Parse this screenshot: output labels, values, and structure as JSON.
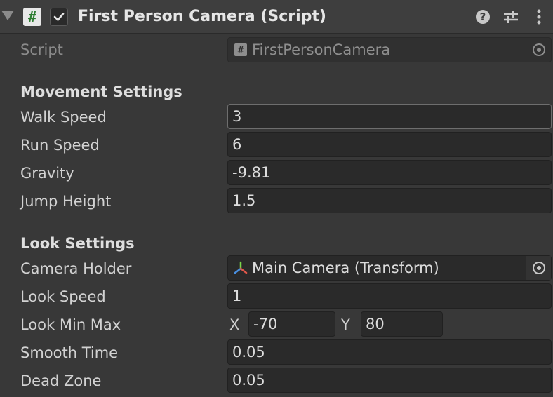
{
  "component": {
    "title": "First Person Camera (Script)",
    "enabled": true,
    "icons": {
      "script": "#",
      "help": "help-icon",
      "presets": "sliders-icon",
      "menu": "kebab-menu-icon"
    }
  },
  "script_field": {
    "label": "Script",
    "value": "FirstPersonCamera"
  },
  "movement": {
    "heading": "Movement Settings",
    "walk_speed": {
      "label": "Walk Speed",
      "value": "3"
    },
    "run_speed": {
      "label": "Run Speed",
      "value": "6"
    },
    "gravity": {
      "label": "Gravity",
      "value": "-9.81"
    },
    "jump_height": {
      "label": "Jump Height",
      "value": "1.5"
    }
  },
  "look": {
    "heading": "Look Settings",
    "camera_holder": {
      "label": "Camera Holder",
      "value": "Main Camera (Transform)"
    },
    "look_speed": {
      "label": "Look Speed",
      "value": "1"
    },
    "look_min_max": {
      "label": "Look Min Max",
      "x_label": "X",
      "x_value": "-70",
      "y_label": "Y",
      "y_value": "80"
    },
    "smooth_time": {
      "label": "Smooth Time",
      "value": "0.05"
    },
    "dead_zone": {
      "label": "Dead Zone",
      "value": "0.05"
    }
  },
  "colors": {
    "background": "#383838",
    "header": "#3e3e3e",
    "field": "#2a2a2a",
    "script_icon_green": "#2e7d32"
  }
}
